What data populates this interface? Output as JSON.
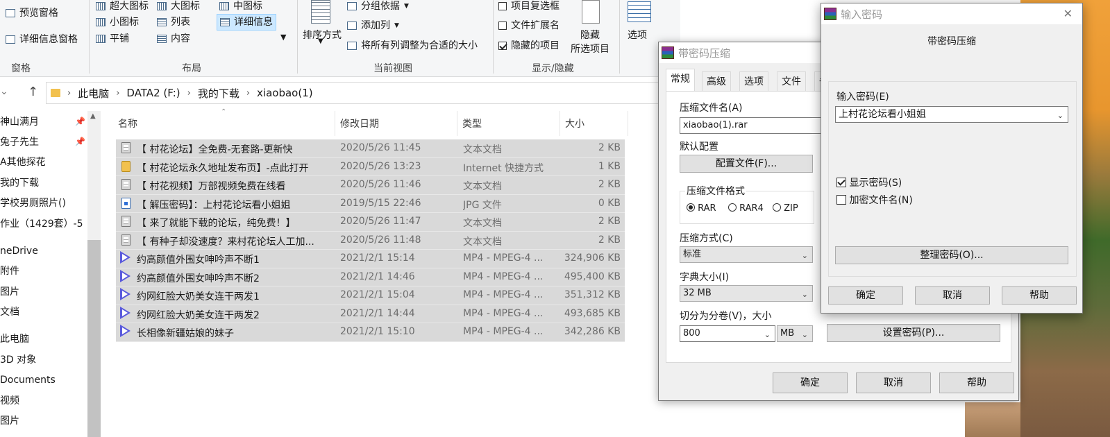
{
  "ribbon": {
    "pane": {
      "preview_pane": "预览窗格",
      "details_pane": "详细信息窗格",
      "label": "窗格"
    },
    "layout": {
      "extra_large_icons": "超大图标",
      "large_icons": "大图标",
      "medium_icons": "中图标",
      "small_icons": "小图标",
      "list": "列表",
      "details": "详细信息",
      "tiles": "平铺",
      "content": "内容",
      "label": "布局"
    },
    "current_view": {
      "sort_by": "排序方式",
      "group_by": "分组依据",
      "add_columns": "添加列",
      "size_all_columns": "将所有列调整为合适的大小",
      "label": "当前视图"
    },
    "show_hide": {
      "item_checkboxes": "项目复选框",
      "file_name_extensions": "文件扩展名",
      "hidden_items": "隐藏的项目",
      "hide_selected": "隐藏\n所选项目",
      "hide_line1": "隐藏",
      "hide_line2": "所选项目",
      "label": "显示/隐藏",
      "item_checkboxes_checked": false,
      "file_name_extensions_checked": false,
      "hidden_items_checked": true
    },
    "options": "选项"
  },
  "address": {
    "crumbs": [
      "此电脑",
      "DATA2 (F:)",
      "我的下载",
      "xiaobao(1)"
    ]
  },
  "nav": {
    "items": [
      "神山满月",
      "兔子先生",
      "A其他探花",
      "我的下载",
      "学校男厕照片()",
      "作业（1429套）-5",
      "neDrive",
      "附件",
      "图片",
      "文档",
      "此电脑",
      "3D 对象",
      "Documents",
      "视频",
      "图片"
    ]
  },
  "columns": {
    "name": "名称",
    "date": "修改日期",
    "type": "类型",
    "size": "大小"
  },
  "files": [
    {
      "icon": "text-file-icon",
      "name": "【 村花论坛】全免费-无套路-更新快",
      "date": "2020/5/26 11:45",
      "type": "文本文档",
      "size": "2 KB"
    },
    {
      "icon": "internet-shortcut-icon",
      "name": "【 村花论坛永久地址发布页】-点此打开",
      "date": "2020/5/26 13:23",
      "type": "Internet 快捷方式",
      "size": "1 KB"
    },
    {
      "icon": "text-file-icon",
      "name": "【 村花视频】万部视频免费在线看",
      "date": "2020/5/26 11:46",
      "type": "文本文档",
      "size": "2 KB"
    },
    {
      "icon": "jpg-file-icon",
      "name": "【 解压密码】：上村花论坛看小姐姐",
      "date": "2019/5/15 22:46",
      "type": "JPG 文件",
      "size": "0 KB"
    },
    {
      "icon": "text-file-icon",
      "name": "【 来了就能下载的论坛，纯免费！】",
      "date": "2020/5/26 11:47",
      "type": "文本文档",
      "size": "2 KB"
    },
    {
      "icon": "text-file-icon",
      "name": "【 有种子却没速度？来村花论坛人工加...",
      "date": "2020/5/26 11:48",
      "type": "文本文档",
      "size": "2 KB"
    },
    {
      "icon": "video-file-icon",
      "name": "约高颜值外围女呻吟声不断1",
      "date": "2021/2/1 15:14",
      "type": "MP4 - MPEG-4 ...",
      "size": "324,906 KB"
    },
    {
      "icon": "video-file-icon",
      "name": "约高颜值外围女呻吟声不断2",
      "date": "2021/2/1 14:46",
      "type": "MP4 - MPEG-4 ...",
      "size": "495,400 KB"
    },
    {
      "icon": "video-file-icon",
      "name": "约网红脸大奶美女连干两发1",
      "date": "2021/2/1 15:04",
      "type": "MP4 - MPEG-4 ...",
      "size": "351,312 KB"
    },
    {
      "icon": "video-file-icon",
      "name": "约网红脸大奶美女连干两发2",
      "date": "2021/2/1 14:44",
      "type": "MP4 - MPEG-4 ...",
      "size": "493,685 KB"
    },
    {
      "icon": "video-file-icon",
      "name": "长相像新疆姑娘的妹子",
      "date": "2021/2/1 15:10",
      "type": "MP4 - MPEG-4 ...",
      "size": "342,286 KB"
    }
  ],
  "archive_dialog": {
    "title": "带密码压缩",
    "tabs": [
      "常规",
      "高级",
      "选项",
      "文件",
      "备"
    ],
    "archive_name_label": "压缩文件名(A)",
    "archive_name_value": "xiaobao(1).rar",
    "default_profile_label": "默认配置",
    "profiles_button": "配置文件(F)...",
    "format_label": "压缩文件格式",
    "formats": [
      "RAR",
      "RAR4",
      "ZIP"
    ],
    "selected_format": "RAR",
    "method_label": "压缩方式(C)",
    "method_value": "标准",
    "dict_label": "字典大小(I)",
    "dict_value": "32 MB",
    "split_label": "切分为分卷(V)，大小",
    "split_value": "800",
    "split_unit": "MB",
    "set_password_button": "设置密码(P)...",
    "ok": "确定",
    "cancel": "取消",
    "help": "帮助"
  },
  "password_dialog": {
    "title": "输入密码",
    "heading": "带密码压缩",
    "enter_password_label": "输入密码(E)",
    "password_value": "上村花论坛看小姐姐",
    "show_password": "显示密码(S)",
    "show_password_checked": true,
    "encrypt_names": "加密文件名(N)",
    "encrypt_names_checked": false,
    "organize_button": "整理密码(O)...",
    "ok": "确定",
    "cancel": "取消",
    "help": "帮助",
    "close_glyph": "✕"
  }
}
